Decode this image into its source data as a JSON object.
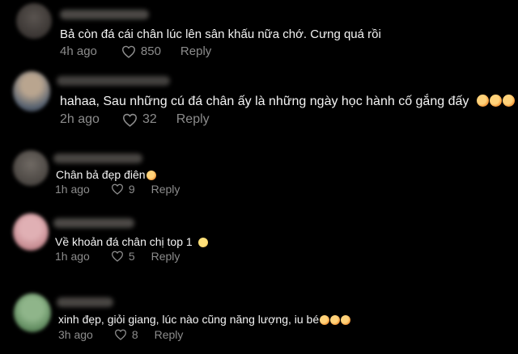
{
  "comments": [
    {
      "text": "Bả còn đá cái chân lúc lên sân khấu nữa chớ. Cưng quá rồi",
      "time": "4h ago",
      "likes": "850",
      "reply": "Reply",
      "emoji_count": 0
    },
    {
      "text": "hahaa, Sau những cú đá chân ấy là những ngày học hành cố gắng đấy",
      "time": "2h ago",
      "likes": "32",
      "reply": "Reply",
      "emoji_count": 3
    },
    {
      "text": "Chân bả đẹp điên",
      "time": "1h ago",
      "likes": "9",
      "reply": "Reply",
      "emoji_count": 1
    },
    {
      "text": "Về khoản đá chân chị top 1",
      "time": "1h ago",
      "likes": "5",
      "reply": "Reply",
      "emoji_count": 1
    },
    {
      "text": "xinh đẹp, giỏi giang, lúc nào cũng năng lượng, iu bé",
      "time": "3h ago",
      "likes": "8",
      "reply": "Reply",
      "emoji_count": 3
    }
  ],
  "icons": {
    "like": "heart-outline-icon",
    "emoji": "smiling-face-with-hearts-emoji"
  },
  "colors": {
    "background": "#000000",
    "text": "#f4f4f4",
    "meta": "#8c8c8c"
  }
}
